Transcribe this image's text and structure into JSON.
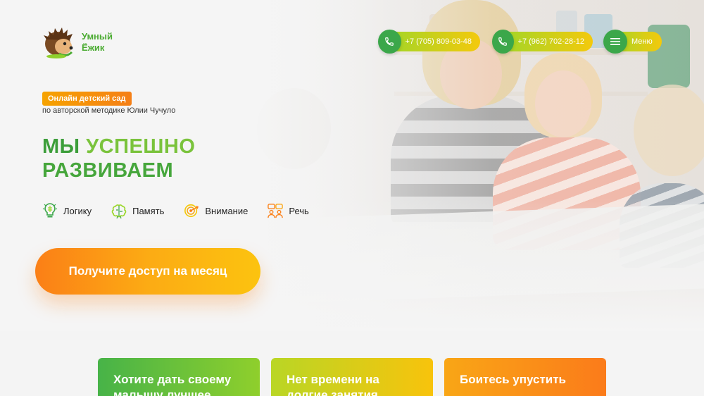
{
  "header": {
    "logo_line1": "Умный",
    "logo_line2": "Ёжик",
    "phone1": "+7 (705) 809-03-48",
    "phone2": "+7 (962) 702-28-12",
    "menu_label": "Меню"
  },
  "hero": {
    "badge": "Онлайн детский сад",
    "subtitle": "по авторской методике Юлии Чучуло",
    "headline_word1": "МЫ",
    "headline_word2": "УСПЕШНО",
    "headline_word3": "РАЗВИВАЕМ",
    "skills": [
      {
        "label": "Логику",
        "icon": "lightbulb-brain-icon"
      },
      {
        "label": "Память",
        "icon": "brain-icon"
      },
      {
        "label": "Внимание",
        "icon": "target-icon"
      },
      {
        "label": "Речь",
        "icon": "speech-people-icon"
      }
    ],
    "cta_label": "Получите доступ на месяц"
  },
  "cards": [
    {
      "line1": "Хотите дать своему",
      "line2": "малышу лучшее"
    },
    {
      "line1": "Нет времени на",
      "line2": "долгие занятия"
    },
    {
      "line1": "Боитесь упустить",
      "line2": ""
    }
  ],
  "colors": {
    "brand_green": "#3ba74a",
    "brand_yellow": "#f4c90c",
    "brand_orange": "#fb7f16"
  }
}
